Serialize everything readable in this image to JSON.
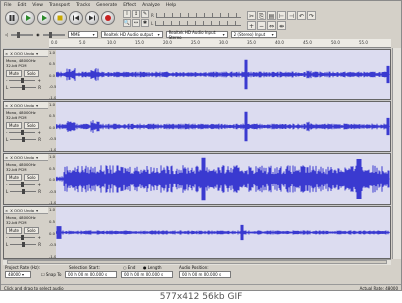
{
  "menu": [
    "File",
    "Edit",
    "View",
    "Transport",
    "Tracks",
    "Generate",
    "Effect",
    "Analyze",
    "Help"
  ],
  "transport": [
    "pause",
    "play",
    "loop",
    "stop",
    "skip-start",
    "skip-end",
    "record"
  ],
  "tools": [
    "I",
    "↕",
    "✎",
    "🔍",
    "↔",
    "✱"
  ],
  "meter": {
    "rows": [
      {
        "label": "R",
        "sub": "L"
      },
      {
        "label": "L",
        "sub": "R"
      }
    ]
  },
  "devices": {
    "host": "MME",
    "output": "Realtek HD Audio output",
    "input": "Realtek HD Audio Input: Stereo",
    "channels": "2 (Stereo) Input"
  },
  "ruler": {
    "ticks": [
      "0.0",
      "5.0",
      "10.0",
      "15.0",
      "20.0",
      "25.0",
      "30.0",
      "35.0",
      "40.0",
      "45.0",
      "50.0",
      "55.0"
    ]
  },
  "tracks": [
    {
      "name": "X OOO Undo",
      "info": "Mono, 48000Hz\n32-bit PCM",
      "mute": "Mute",
      "solo": "Solo",
      "gain_minus": "-",
      "gain_plus": "+",
      "pan_l": "L",
      "pan_r": "R",
      "y": [
        "1.0",
        "0.5",
        "0.0",
        "-0.5",
        "-1.0"
      ]
    },
    {
      "name": "X OOO Undo",
      "info": "Mono, 48000Hz\n32-bit PCM",
      "mute": "Mute",
      "solo": "Solo",
      "gain_minus": "-",
      "gain_plus": "+",
      "pan_l": "L",
      "pan_r": "R",
      "y": [
        "1.0",
        "0.5",
        "0.0",
        "-0.5",
        "-1.0"
      ]
    },
    {
      "name": "X OOO Undo",
      "info": "Mono, 48000Hz\n32-bit PCM",
      "mute": "Mute",
      "solo": "Solo",
      "gain_minus": "-",
      "gain_plus": "+",
      "pan_l": "L",
      "pan_r": "R",
      "y": [
        "1.0",
        "0.5",
        "0.0",
        "-0.5",
        "-1.0"
      ]
    },
    {
      "name": "X OOO Undo",
      "info": "Mono, 48000Hz\n32-bit PCM",
      "mute": "Mute",
      "solo": "Solo",
      "gain_minus": "-",
      "gain_plus": "+",
      "pan_l": "L",
      "pan_r": "R",
      "y": [
        "1.0",
        "0.5",
        "0.0",
        "-0.5",
        "-1.0"
      ]
    }
  ],
  "selection": {
    "project_rate_label": "Project Rate (Hz):",
    "project_rate": "48000",
    "snap_to": "Snap To",
    "sel_start_label": "Selection Start:",
    "sel_start": "00 h 00 m 00.000 s",
    "end_label": "End",
    "length_label": "Length",
    "sel_end": "00 h 00 m 00.000 s",
    "audio_pos_label": "Audio Position:",
    "audio_pos": "00 h 00 m 00.000 s"
  },
  "status": {
    "left": "Click and drag to select audio",
    "right": "Actual Rate: 48000"
  },
  "caption": "577x412  56kb  GIF",
  "colors": {
    "wave": "#3a3ad0",
    "waveBg": "#dcdcf0",
    "chrome": "#d4d0c8"
  }
}
